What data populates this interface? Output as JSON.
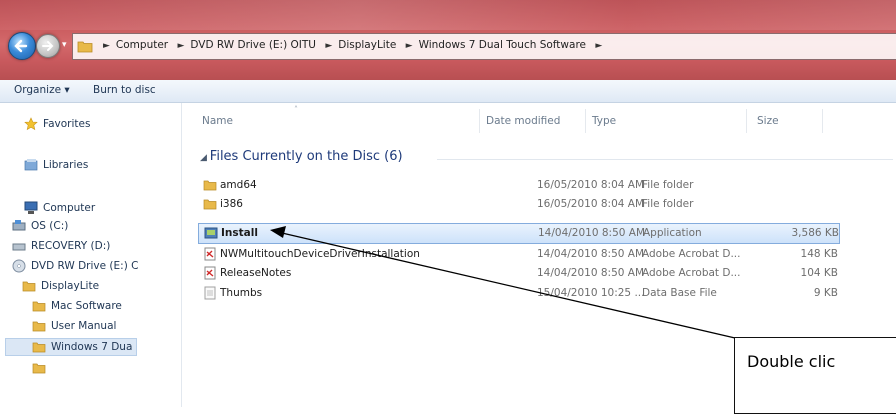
{
  "breadcrumb": [
    "Computer",
    "DVD RW Drive (E:) OITU",
    "DisplayLite",
    "Windows 7 Dual Touch Software"
  ],
  "toolbar": {
    "organize": "Organize ▾",
    "burn": "Burn to disc"
  },
  "nav": {
    "favorites": "Favorites",
    "libraries": "Libraries",
    "computer": "Computer",
    "os": "OS (C:)",
    "recovery": "RECOVERY (D:)",
    "dvd": "DVD RW Drive (E:) C",
    "displaylite": "DisplayLite",
    "mac": "Mac Software",
    "manual": "User Manual",
    "win7": "Windows 7 Dua"
  },
  "columns": {
    "name": "Name",
    "date": "Date modified",
    "type": "Type",
    "size": "Size"
  },
  "group_label": "Files Currently on the Disc (6)",
  "files": [
    {
      "name": "amd64",
      "date": "16/05/2010 8:04 AM",
      "type": "File folder",
      "size": "",
      "icon": "folder-icon"
    },
    {
      "name": "i386",
      "date": "16/05/2010 8:04 AM",
      "type": "File folder",
      "size": "",
      "icon": "folder-icon"
    },
    {
      "name": "Install",
      "date": "14/04/2010 8:50 AM",
      "type": "Application",
      "size": "3,586 KB",
      "icon": "installer-icon"
    },
    {
      "name": "NWMultitouchDeviceDriverInstallationG...",
      "date": "14/04/2010 8:50 AM",
      "type": "Adobe Acrobat D...",
      "size": "148 KB",
      "icon": "pdf-icon"
    },
    {
      "name": "ReleaseNotes",
      "date": "14/04/2010 8:50 AM",
      "type": "Adobe Acrobat D...",
      "size": "104 KB",
      "icon": "pdf-icon"
    },
    {
      "name": "Thumbs",
      "date": "15/04/2010 10:25 ...",
      "type": "Data Base File",
      "size": "9 KB",
      "icon": "db-file-icon"
    }
  ],
  "callout": "Double clic"
}
